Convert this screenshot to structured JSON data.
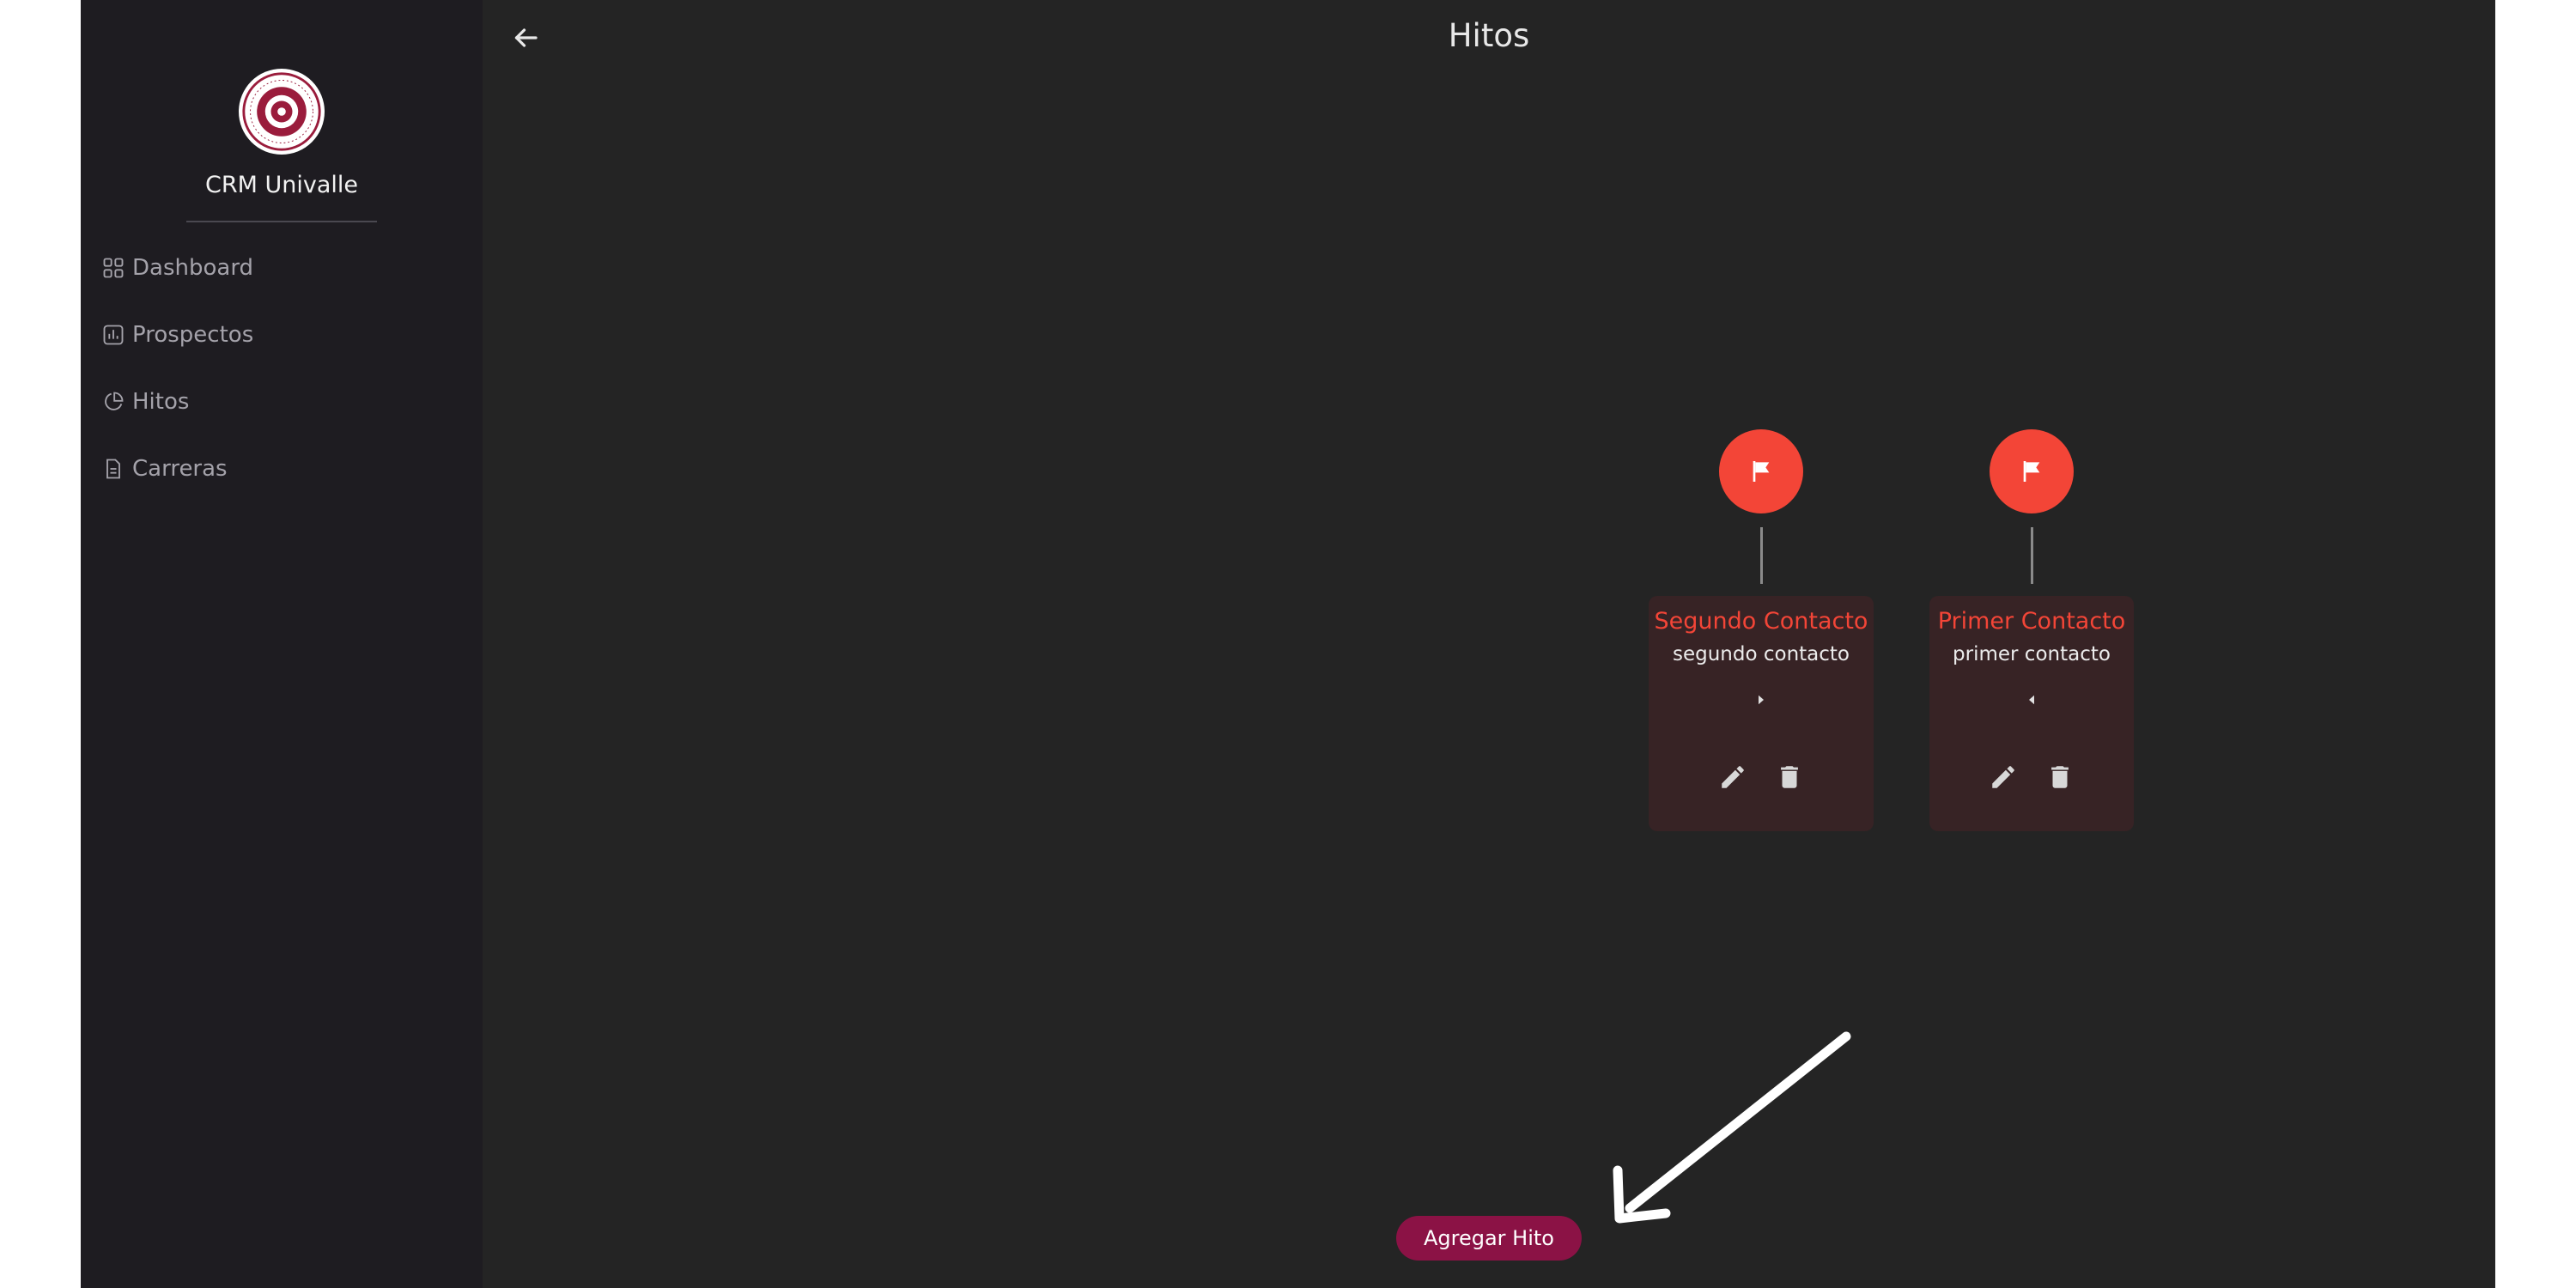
{
  "app": {
    "title": "CRM Univalle"
  },
  "sidebar": {
    "logo_text": "UNIVERSIDAD DEL VALLE · BOLIVIA",
    "items": [
      {
        "label": "Dashboard",
        "icon": "dashboard-grid-icon"
      },
      {
        "label": "Prospectos",
        "icon": "bar-chart-icon"
      },
      {
        "label": "Hitos",
        "icon": "pie-chart-icon"
      },
      {
        "label": "Carreras",
        "icon": "document-icon"
      }
    ]
  },
  "header": {
    "title": "Hitos",
    "back_icon": "arrow-left-icon"
  },
  "milestones": [
    {
      "title": "Segundo Contacto",
      "description": "segundo contacto",
      "arrow": "chevron-right-icon"
    },
    {
      "title": "Primer Contacto",
      "description": "primer contacto",
      "arrow": "chevron-left-icon"
    }
  ],
  "actions": {
    "add_label": "Agregar Hito"
  },
  "colors": {
    "accent": "#f34537",
    "primary_button": "#8b1245",
    "card_bg": "#372325",
    "sidebar_bg": "#1e1c21",
    "main_bg": "#242424"
  }
}
